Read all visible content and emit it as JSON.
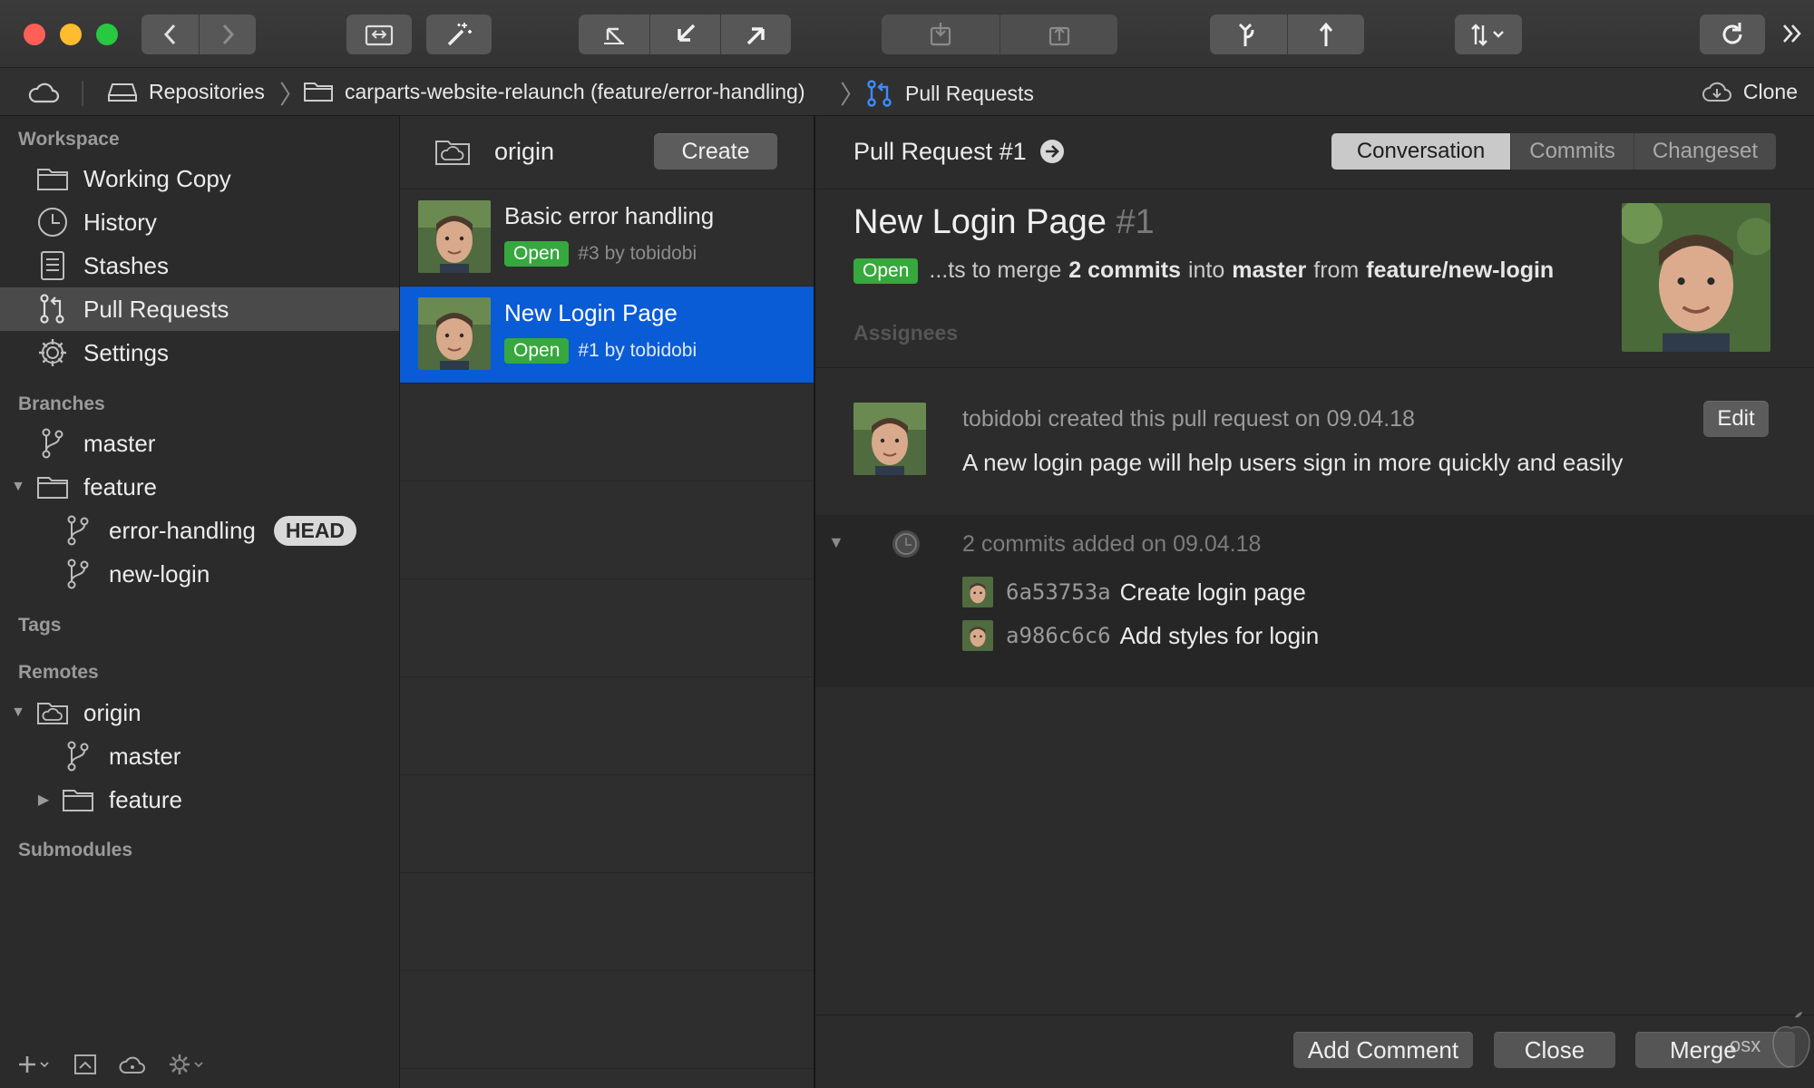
{
  "colors": {
    "accent": "#0a5bd6",
    "open_badge": "#36a83d",
    "close": "#ff5f57",
    "minimize": "#febc2e",
    "zoom": "#28c840"
  },
  "pathbar": {
    "repositories": "Repositories",
    "repo": "carparts-website-relaunch (feature/error-handling)",
    "section": "Pull Requests",
    "clone": "Clone"
  },
  "sidebar": {
    "workspace_header": "Workspace",
    "workspace": [
      {
        "label": "Working Copy",
        "icon": "folder-icon"
      },
      {
        "label": "History",
        "icon": "clock-icon"
      },
      {
        "label": "Stashes",
        "icon": "stash-icon"
      },
      {
        "label": "Pull Requests",
        "icon": "pull-request-icon",
        "selected": true
      },
      {
        "label": "Settings",
        "icon": "gear-icon"
      }
    ],
    "branches_header": "Branches",
    "branches": {
      "master": "master",
      "feature": "feature",
      "error_handling": "error-handling",
      "head": "HEAD",
      "new_login": "new-login"
    },
    "tags_header": "Tags",
    "remotes_header": "Remotes",
    "remotes": {
      "origin": "origin",
      "master": "master",
      "feature": "feature"
    },
    "submodules_header": "Submodules"
  },
  "prlist": {
    "remote": "origin",
    "create": "Create",
    "items": [
      {
        "title": "Basic error handling",
        "status": "Open",
        "meta": "#3 by tobidobi",
        "selected": false
      },
      {
        "title": "New Login Page",
        "status": "Open",
        "meta": "#1 by tobidobi",
        "selected": true
      }
    ]
  },
  "detail": {
    "header_title": "Pull Request #1",
    "tabs": [
      "Conversation",
      "Commits",
      "Changeset"
    ],
    "active_tab": "Conversation",
    "title": "New Login Page",
    "number": "#1",
    "status": "Open",
    "merge_prefix": "...ts to merge",
    "merge_commits": "2 commits",
    "merge_into": "into",
    "merge_target": "master",
    "merge_from": "from",
    "merge_source": "feature/new-login",
    "assignees": "Assignees",
    "comment": {
      "author_line": "tobidobi created this pull request on 09.04.18",
      "body": "A new login page will help users sign in more quickly and easily",
      "edit": "Edit"
    },
    "commits_header": "2 commits added on 09.04.18",
    "commits": [
      {
        "hash": "6a53753a",
        "message": "Create login page"
      },
      {
        "hash": "a986c6c6",
        "message": "Add styles for login"
      }
    ],
    "footer": {
      "add_comment": "Add Comment",
      "close": "Close",
      "merge": "Merge"
    },
    "watermark": "osx"
  }
}
